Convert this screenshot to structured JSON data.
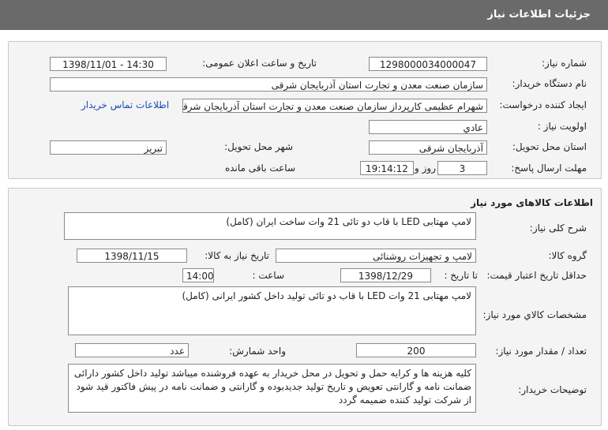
{
  "header": {
    "title": "جزئیات اطلاعات نیاز"
  },
  "info": {
    "need_number_label": "شماره نیاز:",
    "need_number": "1298000034000047",
    "announce_label": "تاریخ و ساعت اعلان عمومی:",
    "announce_value": "1398/11/01 - 14:30",
    "buyer_org_label": "نام دستگاه خریدار:",
    "buyer_org": "سازمان صنعت معدن و تجارت استان آذربایجان شرقی",
    "creator_label": "ایجاد کننده درخواست:",
    "creator": "شهرام عظیمی کارپرداز سازمان صنعت معدن و تجارت استان آذربایجان شرقی",
    "contact_link": "اطلاعات تماس خریدار",
    "priority_label": "اولویت نیاز :",
    "priority": "عادي",
    "province_label": "استان محل تحویل:",
    "province": "آذربایجان شرقی",
    "city_label": "شهر محل تحویل:",
    "city": "تبریز",
    "deadline_label": "مهلت ارسال پاسخ:",
    "days": "3",
    "days_word": "روز و",
    "time_left": "19:14:12",
    "remaining_word": "ساعت باقی مانده"
  },
  "goods": {
    "title": "اطلاعات کالاهای مورد نیاز",
    "general_desc_label": "شرح کلی نیاز:",
    "general_desc": "لامپ مهتابی LED با قاب دو تائی 21 وات ساخت ایران (کامل)",
    "group_label": "گروه کالا:",
    "group": "لامپ و تجهیزات روشنائی",
    "need_date_label": "تاریخ نیاز به کالا:",
    "need_date": "1398/11/15",
    "min_price_label": "حداقل تاریخ اعتبار قیمت:",
    "until_label": "تا تاریخ :",
    "price_date": "1398/12/29",
    "hour_label": "ساعت :",
    "price_time": "14:00",
    "specs_label": "مشخصات کالاي مورد نیاز:",
    "specs": "لامپ مهتابی 21 وات LED با قاب دو تائی تولید داخل کشور ایرانی (کامل)",
    "qty_label": "تعداد / مقدار مورد نیاز:",
    "qty": "200",
    "unit_label": "واحد شمارش:",
    "unit": "عدد",
    "buyer_notes_label": "توضیحات خریدار:",
    "buyer_notes": "کلیه هزینه ها و کرایه حمل و تحویل در محل خریدار به عهده فروشنده میباشد تولید داخل کشور دارائی ضمانت نامه و گارانتی تعویض و تاریخ تولید جدیدبوده و گارانتی و ضمانت نامه در پیش فاکتور قید شود از شرکت تولید کننده ضمیمه گردد"
  }
}
